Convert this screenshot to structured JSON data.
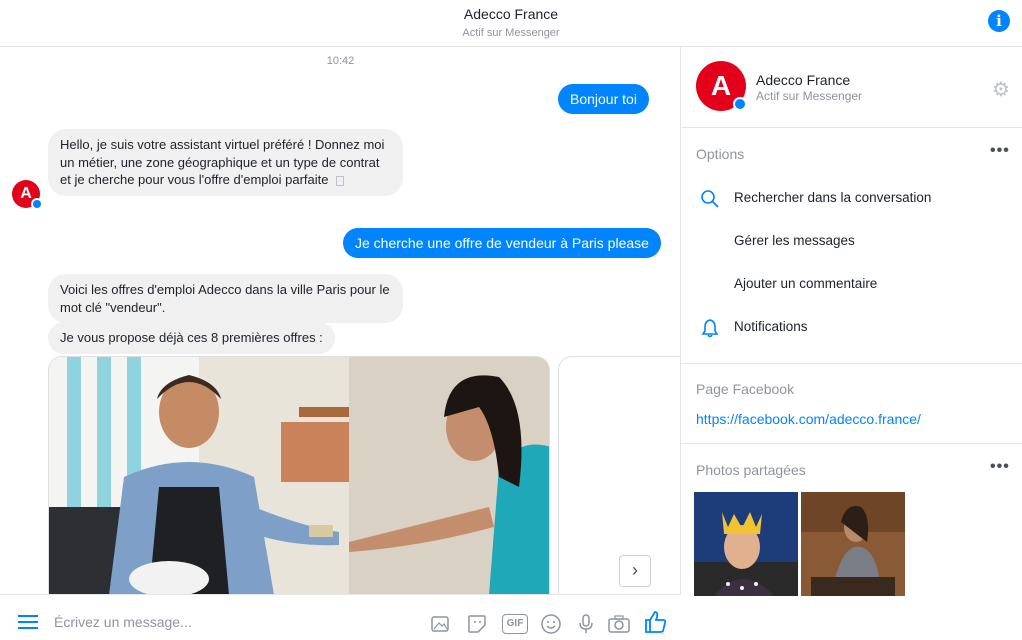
{
  "header": {
    "title": "Adecco France",
    "status": "Actif sur Messenger",
    "info_icon": "i"
  },
  "chat": {
    "timestamp": "10:42",
    "messages": [
      {
        "from": "user",
        "text": "Bonjour toi"
      },
      {
        "from": "bot",
        "text": "Hello, je suis votre assistant virtuel préféré ! Donnez moi un métier, une zone géographique et un type de contrat et je cherche pour vous l'offre d'emploi parfaite"
      },
      {
        "from": "user",
        "text": "Je cherche une offre de vendeur à Paris please"
      },
      {
        "from": "bot",
        "text": "Voici les offres d'emploi Adecco dans la ville Paris pour le mot clé \"vendeur\"."
      },
      {
        "from": "bot",
        "text": "Je vous propose déjà ces 8 premières offres :"
      }
    ],
    "next_label": "›"
  },
  "composer": {
    "placeholder": "Écrivez un message...",
    "gif_label": "GIF"
  },
  "sidebar": {
    "name": "Adecco France",
    "status": "Actif sur Messenger",
    "avatar_letter": "A",
    "options_title": "Options",
    "options": [
      {
        "label": "Rechercher dans la conversation",
        "icon": "search-icon"
      },
      {
        "label": "Gérer les messages",
        "icon": ""
      },
      {
        "label": "Ajouter un commentaire",
        "icon": ""
      },
      {
        "label": "Notifications",
        "icon": "bell-icon"
      }
    ],
    "page_title": "Page Facebook",
    "page_link": "https://facebook.com/adecco.france/",
    "photos_title": "Photos partagées",
    "more": "•••"
  },
  "colors": {
    "accent": "#0084ff",
    "brand": "#e2001a",
    "bubble_in": "#f1f0f0"
  }
}
